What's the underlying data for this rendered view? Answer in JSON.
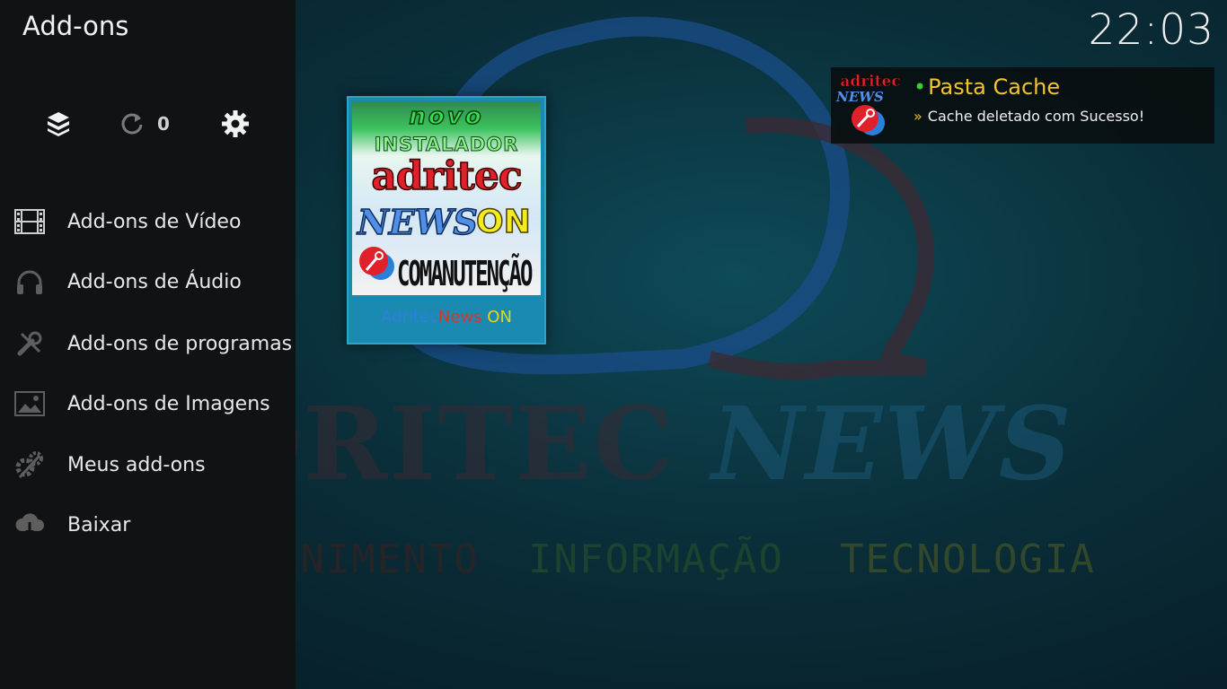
{
  "header": {
    "title": "Add-ons",
    "clock": "22:03"
  },
  "toolbar": {
    "addon_browser_icon": "addon-box-icon",
    "updates_icon": "refresh-icon",
    "updates_count": "0",
    "settings_icon": "gear-icon"
  },
  "sidebar": {
    "items": [
      {
        "label": "Add-ons de Vídeo",
        "icon": "film-icon"
      },
      {
        "label": "Add-ons de Áudio",
        "icon": "headphones-icon"
      },
      {
        "label": "Add-ons de programas",
        "icon": "wrench-icon"
      },
      {
        "label": "Add-ons de Imagens",
        "icon": "image-icon"
      },
      {
        "label": "Meus add-ons",
        "icon": "gears-icon"
      },
      {
        "label": "Baixar",
        "icon": "cloud-download-icon"
      }
    ]
  },
  "tile": {
    "art_line1": "novo",
    "art_line2": "INSTALADOR",
    "art_line3": "adritec",
    "art_line4": "NEWS",
    "art_line5": "ON",
    "art_line6": "COMANUTENÇÃO",
    "label_part1": "Adritec",
    "label_part2": "News",
    "label_part3": " ON"
  },
  "notification": {
    "logo_line1": "adritec",
    "logo_line2": "NEWS",
    "dot": "•",
    "title": "Pasta Cache",
    "arrow": "»",
    "message": "Cache deletado com Sucesso!"
  },
  "background": {
    "word1": "ADRITEC",
    "word2": "NEWS",
    "tag1": "ENTRETENIMENTO",
    "tag2": "INFORMAÇÃO",
    "tag3": "TECNOLOGIA"
  },
  "colors": {
    "sidebar_bg": "#101314",
    "accent_yellow": "#f3c52a",
    "tile_bg": "#1b8ab0"
  }
}
